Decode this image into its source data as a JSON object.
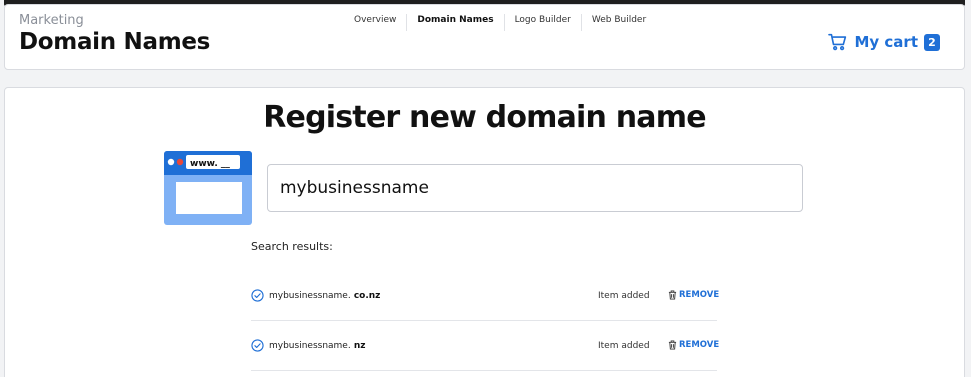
{
  "header": {
    "section": "Marketing",
    "title": "Domain Names",
    "nav": [
      {
        "label": "Overview",
        "active": false
      },
      {
        "label": "Domain Names",
        "active": true
      },
      {
        "label": "Logo Builder",
        "active": false
      },
      {
        "label": "Web Builder",
        "active": false
      }
    ],
    "cart": {
      "label": "My cart",
      "count": "2",
      "icon": "shopping-cart-icon"
    }
  },
  "main": {
    "heading": "Register new domain name",
    "illustration": {
      "url_text": "www. __"
    },
    "search": {
      "value": "mybusinessname"
    },
    "results_label": "Search results:",
    "results": [
      {
        "base": "mybusinessname.",
        "tld": " co.nz",
        "status": "Item added",
        "action": "REMOVE"
      },
      {
        "base": "mybusinessname.",
        "tld": " nz",
        "status": "Item added",
        "action": "REMOVE"
      }
    ]
  },
  "colors": {
    "accent": "#1f6fd6",
    "illustration_dark": "#1f6fd6",
    "illustration_light": "#7fb1f5"
  }
}
